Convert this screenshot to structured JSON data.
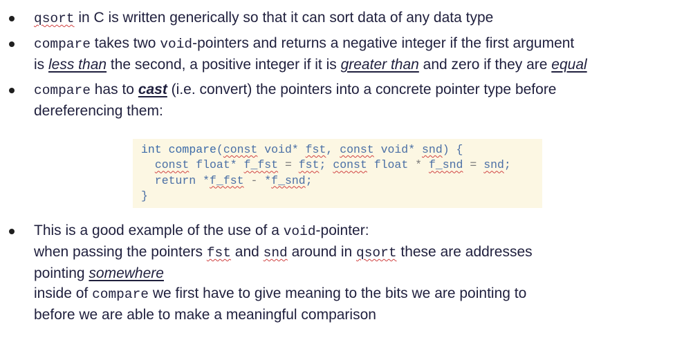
{
  "bullets": [
    {
      "parts": [
        {
          "t": "qsort",
          "mono": true,
          "squiggle": true
        },
        {
          "t": " in C is written generically so that it can sort data of any data type"
        }
      ]
    },
    {
      "lines": [
        [
          {
            "t": "compare",
            "mono": true
          },
          {
            "t": " takes two "
          },
          {
            "t": "void",
            "mono": true
          },
          {
            "t": "-pointers and returns a negative integer if the first argument"
          }
        ],
        [
          {
            "t": "is "
          },
          {
            "t": "less than",
            "em_u": true
          },
          {
            "t": " the second, a positive integer if it is "
          },
          {
            "t": "greater than",
            "em_u": true
          },
          {
            "t": " and zero if they are "
          },
          {
            "t": "equal",
            "em_u": true
          }
        ]
      ]
    },
    {
      "lines": [
        [
          {
            "t": "compare",
            "mono": true
          },
          {
            "t": " has to "
          },
          {
            "t": "cast",
            "strong_em_u": true
          },
          {
            "t": " (i.e. convert) the pointers into a concrete pointer type before"
          }
        ],
        [
          {
            "t": "dereferencing them:"
          }
        ]
      ]
    },
    {
      "lines": [
        [
          {
            "t": "This is a good example of the use of a "
          },
          {
            "t": "void",
            "mono": true
          },
          {
            "t": "-pointer:"
          }
        ],
        [
          {
            "t": "when passing the pointers "
          },
          {
            "t": "fst",
            "mono": true,
            "squiggle": true
          },
          {
            "t": " and "
          },
          {
            "t": "snd",
            "mono": true,
            "squiggle": true
          },
          {
            "t": " around in "
          },
          {
            "t": "qsort",
            "mono": true,
            "squiggle": true
          },
          {
            "t": " these are addresses"
          }
        ],
        [
          {
            "t": "pointing "
          },
          {
            "t": "somewhere",
            "em_u": true
          }
        ],
        [
          {
            "t": "inside of "
          },
          {
            "t": "compare",
            "mono": true
          },
          {
            "t": " we first have to give meaning to the bits we are pointing to"
          }
        ],
        [
          {
            "t": "before we are able to make a meaningful comparison"
          }
        ]
      ]
    }
  ],
  "code": {
    "lines": [
      [
        {
          "t": "int ",
          "c": "kw"
        },
        {
          "t": "compare",
          "c": "fn"
        },
        {
          "t": "("
        },
        {
          "t": "const",
          "sq": true
        },
        {
          "t": " void* "
        },
        {
          "t": "fst",
          "sq": true
        },
        {
          "t": ", "
        },
        {
          "t": "const",
          "sq": true
        },
        {
          "t": " void* "
        },
        {
          "t": "snd",
          "sq": true
        },
        {
          "t": ") {"
        }
      ],
      [
        {
          "t": "  "
        },
        {
          "t": "const",
          "sq": true
        },
        {
          "t": " float* "
        },
        {
          "t": "f_fst",
          "sq": true
        },
        {
          "t": " = ",
          "c": "op"
        },
        {
          "t": "fst",
          "sq": true
        },
        {
          "t": "; "
        },
        {
          "t": "const",
          "sq": true
        },
        {
          "t": " float "
        },
        {
          "t": "*",
          "c": "op"
        },
        {
          "t": " "
        },
        {
          "t": "f_snd",
          "sq": true
        },
        {
          "t": " = ",
          "c": "op"
        },
        {
          "t": "snd",
          "sq": true
        },
        {
          "t": ";"
        }
      ],
      [
        {
          "t": "  return "
        },
        {
          "t": "*"
        },
        {
          "t": "f_fst",
          "sq": true
        },
        {
          "t": " - ",
          "c": "op"
        },
        {
          "t": "*"
        },
        {
          "t": "f_snd",
          "sq": true
        },
        {
          "t": ";"
        }
      ],
      [
        {
          "t": "}"
        }
      ]
    ]
  }
}
